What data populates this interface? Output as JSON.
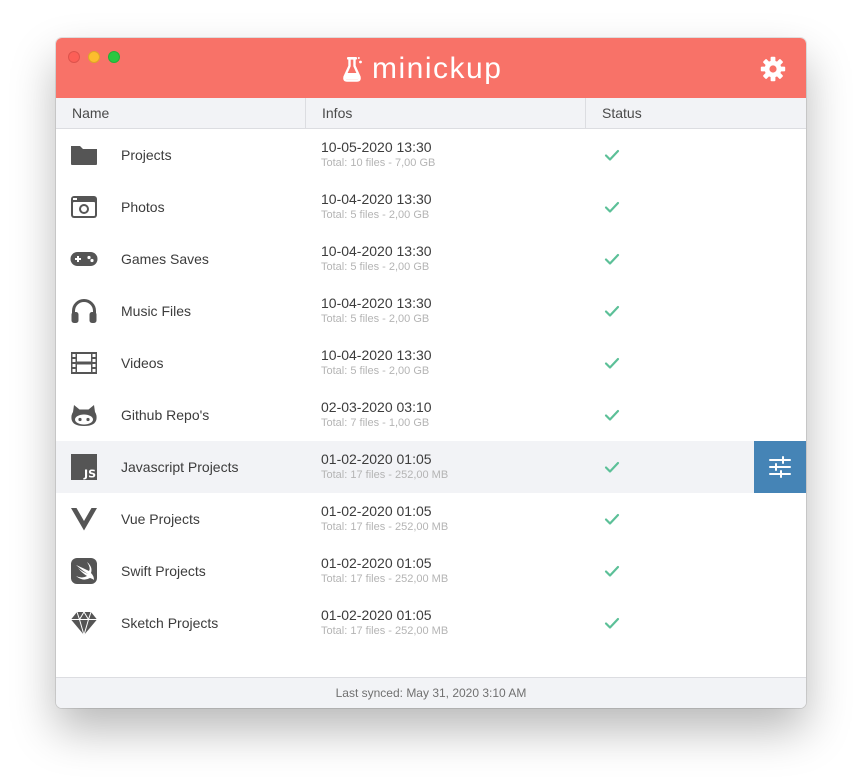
{
  "app": {
    "title": "minickup",
    "icons": {
      "logo": "flask-icon",
      "settings": "gear-icon"
    },
    "colors": {
      "titlebar": "#f87268",
      "accent": "#4584b6",
      "check": "#5cc098"
    }
  },
  "table": {
    "columns": {
      "name": "Name",
      "infos": "Infos",
      "status": "Status"
    },
    "rows": [
      {
        "icon": "folder-icon",
        "name": "Projects",
        "date": "10-05-2020 13:30",
        "total": "Total: 10 files - 7,00 GB",
        "status": "check-icon"
      },
      {
        "icon": "camera-icon",
        "name": "Photos",
        "date": "10-04-2020 13:30",
        "total": "Total: 5 files - 2,00 GB",
        "status": "check-icon"
      },
      {
        "icon": "gamepad-icon",
        "name": "Games Saves",
        "date": "10-04-2020 13:30",
        "total": "Total: 5 files - 2,00 GB",
        "status": "check-icon"
      },
      {
        "icon": "headphones-icon",
        "name": "Music Files",
        "date": "10-04-2020 13:30",
        "total": "Total: 5 files - 2,00 GB",
        "status": "check-icon"
      },
      {
        "icon": "film-icon",
        "name": "Videos",
        "date": "10-04-2020 13:30",
        "total": "Total: 5 files - 2,00 GB",
        "status": "check-icon"
      },
      {
        "icon": "github-icon",
        "name": "Github Repo's",
        "date": "02-03-2020 03:10",
        "total": "Total: 7 files - 1,00 GB",
        "status": "check-icon"
      },
      {
        "icon": "javascript-icon",
        "name": "Javascript Projects",
        "date": "01-02-2020 01:05",
        "total": "Total: 17 files - 252,00 MB",
        "status": "check-icon",
        "selected": true,
        "action_icon": "sliders-icon"
      },
      {
        "icon": "vue-icon",
        "name": "Vue Projects",
        "date": "01-02-2020 01:05",
        "total": "Total: 17 files - 252,00 MB",
        "status": "check-icon"
      },
      {
        "icon": "swift-icon",
        "name": "Swift Projects",
        "date": "01-02-2020 01:05",
        "total": "Total: 17 files - 252,00 MB",
        "status": "check-icon"
      },
      {
        "icon": "sketch-icon",
        "name": "Sketch Projects",
        "date": "01-02-2020 01:05",
        "total": "Total: 17 files - 252,00 MB",
        "status": "check-icon"
      }
    ]
  },
  "footer": {
    "sync_text": "Last synced: May 31, 2020 3:10 AM"
  }
}
